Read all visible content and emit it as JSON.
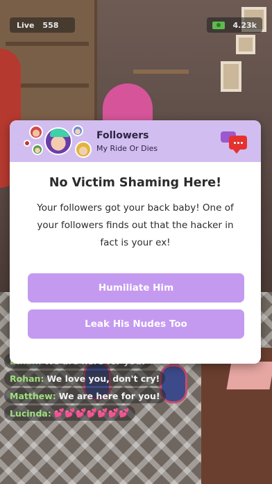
{
  "hud": {
    "live_label": "Live",
    "live_count": "558",
    "money_icon": "cash-icon",
    "money_value": "4.23k"
  },
  "modal": {
    "header": {
      "title": "Followers",
      "subtitle": "My Ride Or Dies",
      "icon": "chat-bubbles-icon"
    },
    "title": "No Victim Shaming Here!",
    "body": "Your followers got your back baby! One of your followers finds out that the hacker in fact is your ex!",
    "choices": [
      {
        "label": "Humiliate Him"
      },
      {
        "label": "Leak His Nudes Too"
      }
    ]
  },
  "chat": [
    {
      "name": "Ethan:",
      "text": "We are here for you!"
    },
    {
      "name": "Rohan:",
      "text": "We love you, don't cry!"
    },
    {
      "name": "Matthew:",
      "text": "We are here for you!"
    },
    {
      "name": "Lucinda:",
      "text": "💕💕💕💕💕💕💕"
    }
  ],
  "colors": {
    "modal_header": "#d2bdf0",
    "choice_button": "#c49af0",
    "chat_name": "#9fe07d"
  }
}
